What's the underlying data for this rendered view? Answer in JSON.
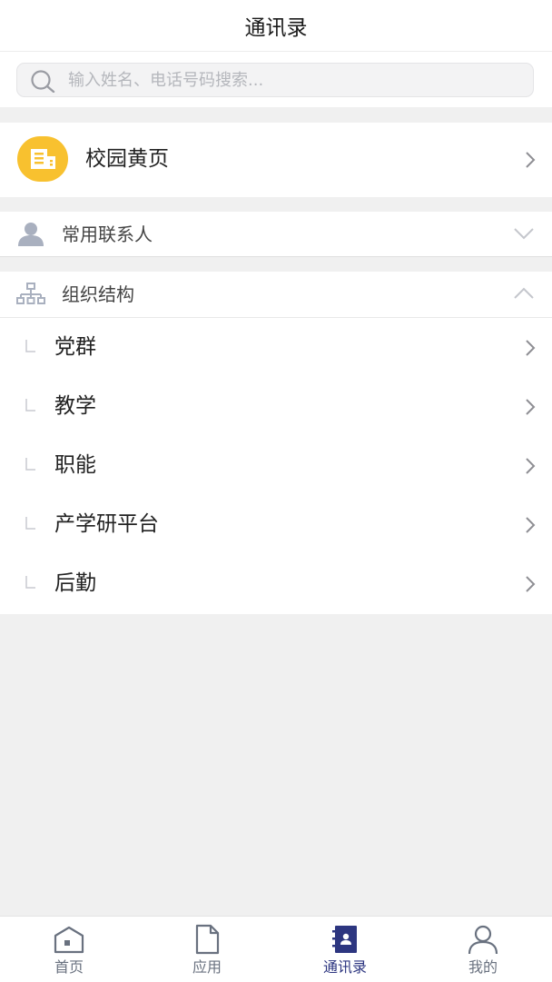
{
  "header": {
    "title": "通讯录"
  },
  "search": {
    "placeholder": "输入姓名、电话号码搜索...",
    "value": "",
    "icon": "search-icon"
  },
  "yellow_pages": {
    "label": "校园黄页",
    "icon": "building-icon"
  },
  "frequent_contacts": {
    "label": "常用联系人",
    "icon": "person-icon",
    "state": "collapsed"
  },
  "org_structure": {
    "label": "组织结构",
    "icon": "org-tree-icon",
    "state": "expanded",
    "items": [
      {
        "label": "党群"
      },
      {
        "label": "教学"
      },
      {
        "label": "职能"
      },
      {
        "label": "产学研平台"
      },
      {
        "label": "后勤"
      }
    ]
  },
  "tabbar": {
    "active": "通讯录",
    "tabs": [
      {
        "label": "首页",
        "icon": "home-icon"
      },
      {
        "label": "应用",
        "icon": "document-icon"
      },
      {
        "label": "通讯录",
        "icon": "contacts-book-icon"
      },
      {
        "label": "我的",
        "icon": "user-icon"
      }
    ]
  },
  "colors": {
    "accent": "#2d3680",
    "yellow": "#f8c12f",
    "background": "#f0f0f0"
  }
}
